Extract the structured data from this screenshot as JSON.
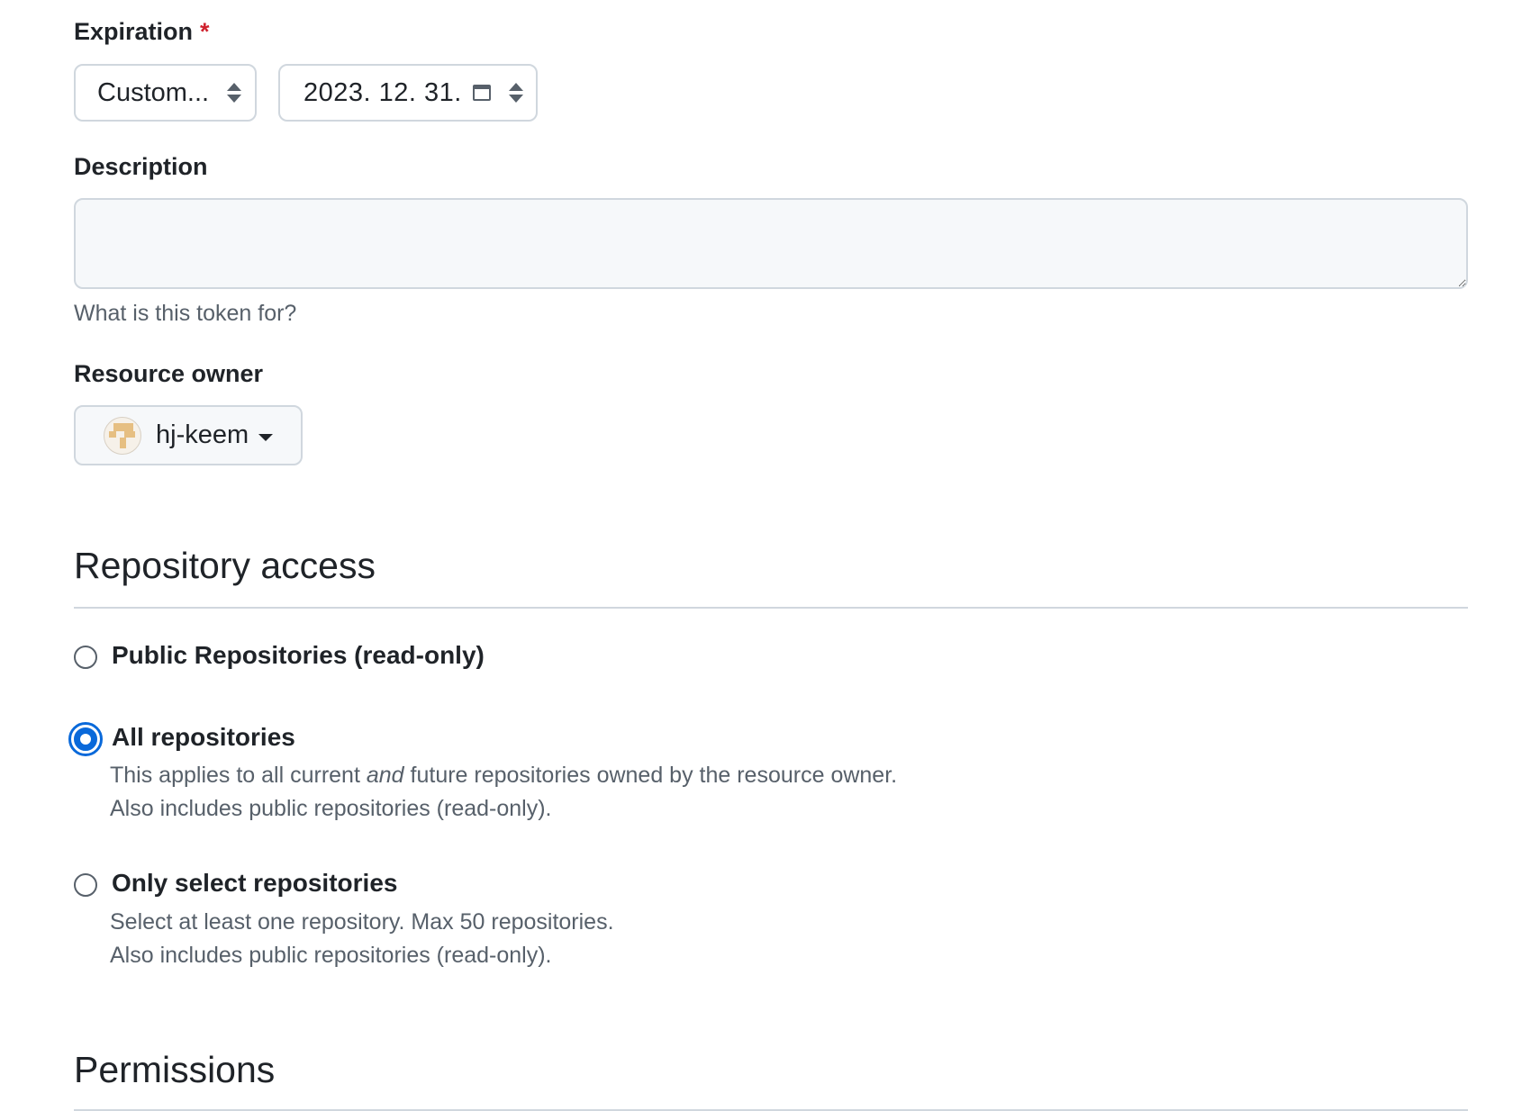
{
  "expiration": {
    "label": "Expiration",
    "required_mark": "*",
    "preset_value": "Custom...",
    "date_value": "2023. 12. 31."
  },
  "description": {
    "label": "Description",
    "value": "",
    "hint": "What is this token for?"
  },
  "resource_owner": {
    "label": "Resource owner",
    "value": "hj-keem"
  },
  "repository_access": {
    "heading": "Repository access",
    "options": [
      {
        "title": "Public Repositories (read-only)",
        "selected": false
      },
      {
        "title": "All repositories",
        "selected": true,
        "desc_before": "This applies to all current ",
        "desc_em": "and",
        "desc_after": " future repositories owned by the resource owner.",
        "desc_line2": "Also includes public repositories (read-only)."
      },
      {
        "title": "Only select repositories",
        "selected": false,
        "desc_line1": "Select at least one repository. Max 50 repositories.",
        "desc_line2": "Also includes public repositories (read-only)."
      }
    ]
  },
  "permissions": {
    "heading": "Permissions"
  },
  "colors": {
    "accent": "#0969da",
    "required": "#cf222e",
    "border": "#d0d7de",
    "muted_text": "#57606a"
  }
}
